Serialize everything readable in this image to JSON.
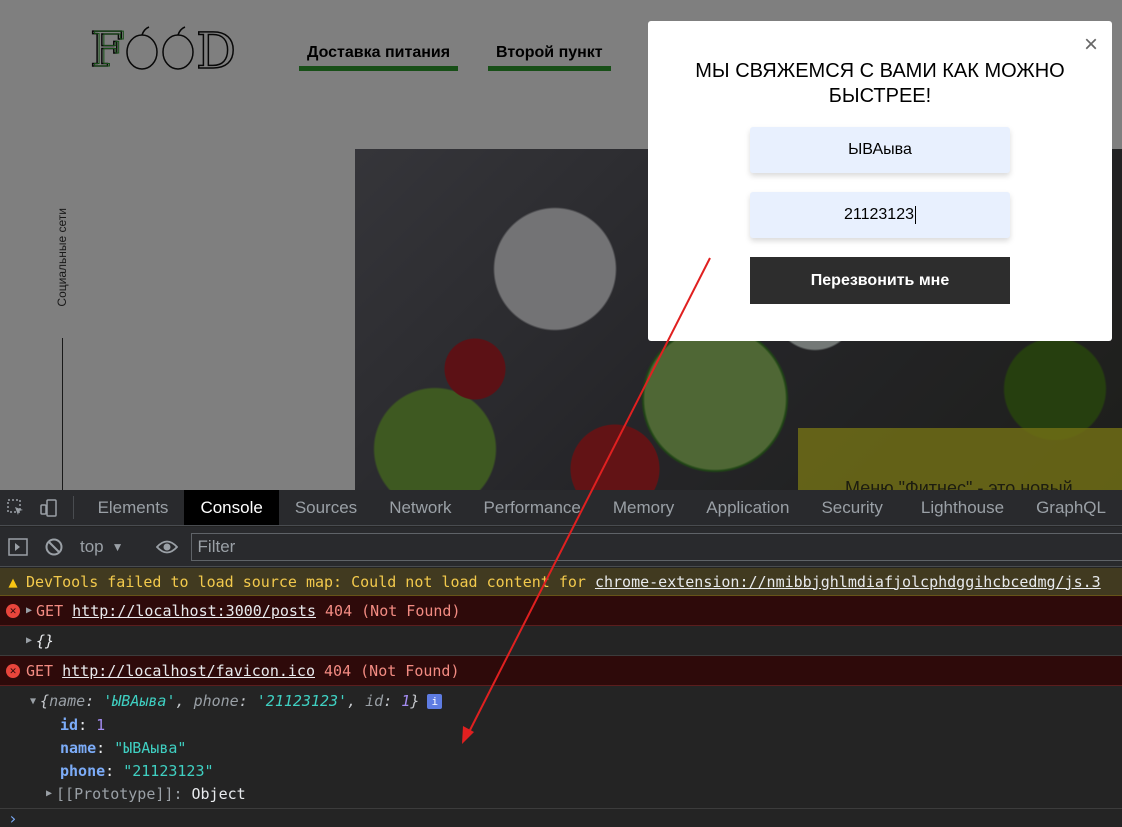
{
  "site": {
    "logo": "FOOD",
    "nav": [
      "Доставка питания",
      "Второй пункт"
    ],
    "social": "Социальные сети",
    "promo": "Меню \"Фитнес\" - это новый"
  },
  "modal": {
    "close": "×",
    "title": "МЫ СВЯЖЕМСЯ С ВАМИ КАК МОЖНО БЫСТРЕЕ!",
    "name_value": "ЫВАыва",
    "phone_value": "21123123",
    "submit_label": "Перезвонить мне"
  },
  "devtools": {
    "tabs": [
      "Elements",
      "Console",
      "Sources",
      "Network",
      "Performance",
      "Memory",
      "Application",
      "Security",
      "Lighthouse",
      "GraphQL"
    ],
    "active_tab": "Console",
    "context": "top",
    "filter_placeholder": "Filter",
    "messages": {
      "warning_prefix": "DevTools failed to load source map: Could not load content for ",
      "warning_link": "chrome-extension://nmibbjghlmdiafjolcphdggihcbcedmg/js.3",
      "err1_method": "GET",
      "err1_url": "http://localhost:3000/posts",
      "err1_status": "404 (Not Found)",
      "empty_obj": "{}",
      "err2_method": "GET",
      "err2_url": "http://localhost/favicon.ico",
      "err2_status": "404 (Not Found)",
      "obj_summary": {
        "name_key": "name",
        "name_val": "'ЫВАыва'",
        "phone_key": "phone",
        "phone_val": "'21123123'",
        "id_key": "id",
        "id_val": "1"
      },
      "props": [
        {
          "key": "id",
          "value": "1"
        },
        {
          "key": "name",
          "value": "\"ЫВАыва\""
        },
        {
          "key": "phone",
          "value": "\"21123123\""
        }
      ],
      "prototype_label": "[[Prototype]]",
      "prototype_value": "Object"
    },
    "prompt": "›"
  },
  "colors": {
    "nav_underline": "#2e9f2e",
    "button_bg": "#2d2d2d",
    "input_bg": "#e8f0fe",
    "arrow": "#e02020"
  }
}
